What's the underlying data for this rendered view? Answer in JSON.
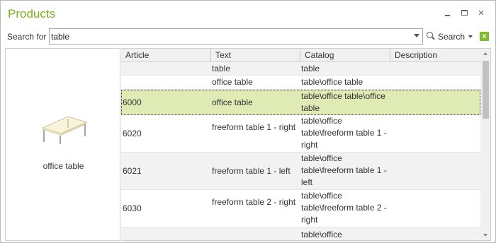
{
  "window": {
    "title": "Products",
    "close_glyph": "×"
  },
  "search": {
    "label": "Search for",
    "value": "table",
    "button_label": "Search",
    "excel_glyph": "x"
  },
  "preview": {
    "label": "office table"
  },
  "grid": {
    "columns": [
      "Article",
      "Text",
      "Catalog",
      "Description"
    ],
    "rows": [
      {
        "article": "",
        "text": "table",
        "catalog": "table",
        "description": ""
      },
      {
        "article": "",
        "text": "office table",
        "catalog": "table\\office table",
        "description": ""
      },
      {
        "article": "6000",
        "text": "office table",
        "catalog": "table\\office table\\office table",
        "description": ""
      },
      {
        "article": "6020",
        "text": "freeform table 1 - right",
        "catalog": "table\\office table\\freeform table 1 - right",
        "description": ""
      },
      {
        "article": "6021",
        "text": "freeform table 1 - left",
        "catalog": "table\\office table\\freeform table 1 - left",
        "description": ""
      },
      {
        "article": "6030",
        "text": "freeform table 2 - right",
        "catalog": "table\\office table\\freeform table 2 - right",
        "description": ""
      },
      {
        "article": "",
        "text": "",
        "catalog": "table\\office",
        "description": ""
      }
    ]
  },
  "colors": {
    "accent": "#7cae1a",
    "selected_row": "#dfeab4",
    "alt_row": "#f2f2f2"
  },
  "icons": {
    "minimize": "minimize-icon",
    "maximize": "maximize-icon",
    "close": "close-icon",
    "search": "search-icon",
    "excel": "excel-icon",
    "dropdown": "chevron-down-icon"
  }
}
